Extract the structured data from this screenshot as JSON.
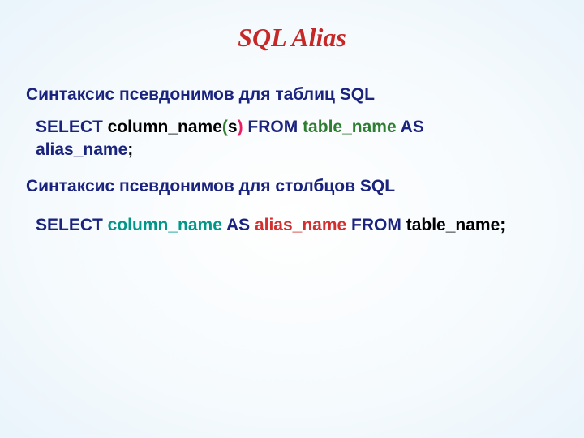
{
  "title": "SQL Alias",
  "section1": {
    "heading": "Синтаксис псевдонимов для таблиц SQL",
    "t1": "SELECT",
    "t2": " column_name",
    "t3": "(",
    "t4": "s",
    "t5": ")",
    "t6": " FROM",
    "t7": " table_name",
    "t8": " AS",
    "t9": "alias_name",
    "t10": ";"
  },
  "section2": {
    "heading": "Синтаксис псевдонимов для столбцов SQL",
    "t1": "SELECT",
    "t2": " column_name",
    "t3": " AS",
    "t4": " alias_name",
    "t5": " FROM",
    "t6": " table_name",
    "t7": ";"
  }
}
